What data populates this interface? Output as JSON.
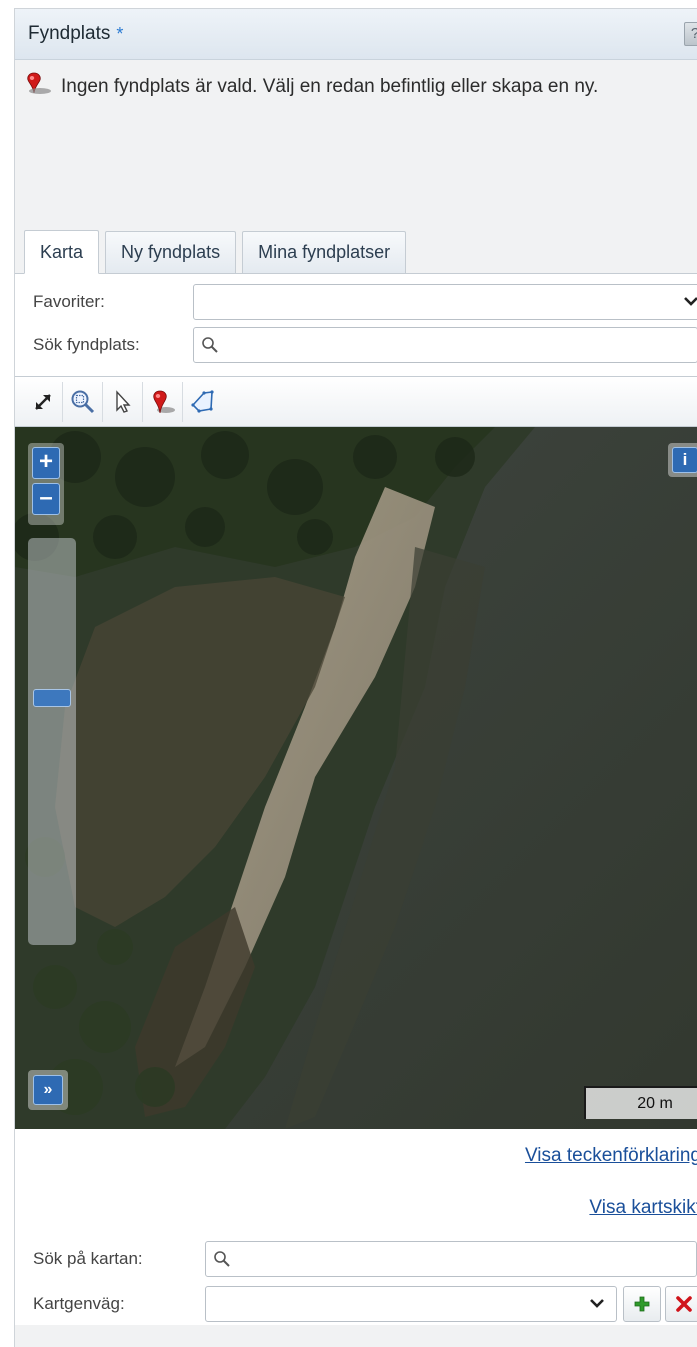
{
  "header": {
    "title": "Fyndplats",
    "required_mark": "*",
    "help_label": "?"
  },
  "message": {
    "text": "Ingen fyndplats är vald. Välj en redan befintlig eller skapa en ny.",
    "icon": "map-pin-icon"
  },
  "tabs": [
    {
      "label": "Karta",
      "active": true
    },
    {
      "label": "Ny fyndplats",
      "active": false
    },
    {
      "label": "Mina fyndplatser",
      "active": false
    }
  ],
  "favorites": {
    "label": "Favoriter:",
    "value": ""
  },
  "search_site": {
    "label": "Sök fyndplats:",
    "value": "",
    "placeholder": ""
  },
  "toolbar": {
    "tools": [
      "expand-icon",
      "zoom-box-icon",
      "select-pointer-icon",
      "place-pin-icon",
      "draw-polygon-icon"
    ]
  },
  "map": {
    "zoom_in_label": "+",
    "zoom_out_label": "–",
    "info_label": "i",
    "expand_label": "»",
    "scale_label": "20 m",
    "zoom_level_fraction": 0.62
  },
  "links": {
    "legend": "Visa teckenförklaring",
    "layers": "Visa kartskikt"
  },
  "search_map": {
    "label": "Sök på kartan:",
    "value": "",
    "placeholder": ""
  },
  "shortcut": {
    "label": "Kartgenväg:",
    "value": ""
  },
  "colors": {
    "accent": "#2e6ab3",
    "link": "#1a4f9a",
    "add": "#2f9a2a",
    "delete": "#d0141b",
    "pin": "#d01a1a"
  }
}
